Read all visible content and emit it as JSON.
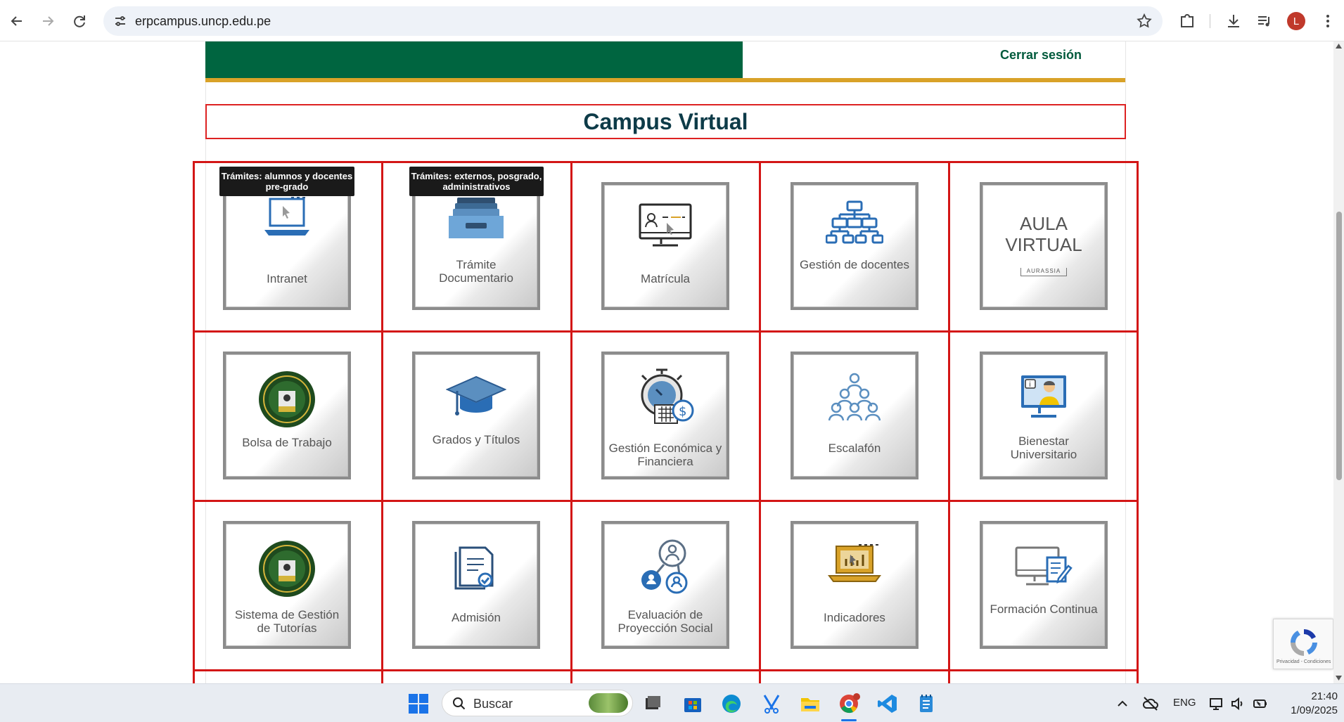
{
  "browser": {
    "url": "erpcampus.uncp.edu.pe",
    "profile_initial": "L"
  },
  "header": {
    "logout_label": "Cerrar sesión",
    "title": "Campus Virtual"
  },
  "tooltips": {
    "intranet": "Trámites: alumnos y docentes pre-grado",
    "tramite": "Trámites: externos, posgrado, administrativos"
  },
  "cards": [
    {
      "label": "Intranet",
      "icon": "laptop-cursor-icon"
    },
    {
      "label": "Trámite Documentario",
      "icon": "file-drawer-icon"
    },
    {
      "label": "Matrícula",
      "icon": "monitor-user-icon"
    },
    {
      "label": "Gestión de docentes",
      "icon": "org-chart-icon"
    },
    {
      "label": "AULA VIRTUAL",
      "sub": "AURASSIA",
      "icon": "aula-virtual-logo"
    },
    {
      "label": "Bolsa de Trabajo",
      "icon": "uncp-seal-icon"
    },
    {
      "label": "Grados y Títulos",
      "icon": "graduation-cap-icon"
    },
    {
      "label": "Gestión Económica y Financiera",
      "icon": "stopwatch-money-icon"
    },
    {
      "label": "Escalafón",
      "icon": "people-group-icon"
    },
    {
      "label": "Bienestar Universitario",
      "icon": "monitor-person-icon"
    },
    {
      "label": "Sistema de Gestión de Tutorías",
      "icon": "uncp-seal-icon"
    },
    {
      "label": "Admisión",
      "icon": "document-check-icon"
    },
    {
      "label": "Evaluación de Proyección Social",
      "icon": "people-network-icon"
    },
    {
      "label": "Indicadores",
      "icon": "laptop-chart-icon"
    },
    {
      "label": "Formación Continua",
      "icon": "monitor-document-icon"
    }
  ],
  "recaptcha": {
    "footer": "Privacidad - Condiciones"
  },
  "taskbar": {
    "search_placeholder": "Buscar",
    "language": "ENG",
    "time": "21:40",
    "date": "1/09/2025"
  },
  "colors": {
    "brand_green": "#006540",
    "gold": "#d9a228",
    "grid_red": "#d31616",
    "title_color": "#0d3b48"
  }
}
